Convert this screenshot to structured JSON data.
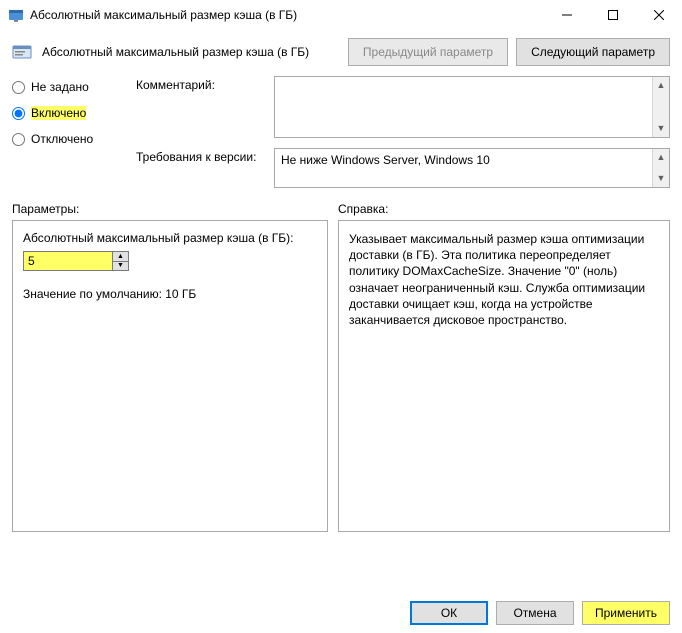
{
  "window": {
    "title": "Абсолютный максимальный размер кэша (в ГБ)"
  },
  "toolbar": {
    "title": "Абсолютный максимальный размер кэша (в ГБ)",
    "prev_label": "Предыдущий параметр",
    "next_label": "Следующий параметр"
  },
  "state": {
    "not_configured": "Не задано",
    "enabled": "Включено",
    "disabled": "Отключено",
    "selected": "enabled"
  },
  "fields": {
    "comment_label": "Комментарий:",
    "comment_value": "",
    "supported_label": "Требования к версии:",
    "supported_value": "Не ниже Windows Server, Windows 10"
  },
  "sections": {
    "options_label": "Параметры:",
    "help_label": "Справка:"
  },
  "options": {
    "cache_label": "Абсолютный максимальный размер кэша (в ГБ):",
    "cache_value": "5",
    "default_text": "Значение по умолчанию: 10 ГБ"
  },
  "help": {
    "text": "Указывает максимальный размер кэша оптимизации доставки (в ГБ). Эта политика переопределяет политику DOMaxCacheSize. Значение \"0\" (ноль) означает неограниченный кэш. Служба оптимизации доставки очищает кэш, когда на устройстве заканчивается дисковое пространство."
  },
  "buttons": {
    "ok": "ОК",
    "cancel": "Отмена",
    "apply": "Применить"
  }
}
